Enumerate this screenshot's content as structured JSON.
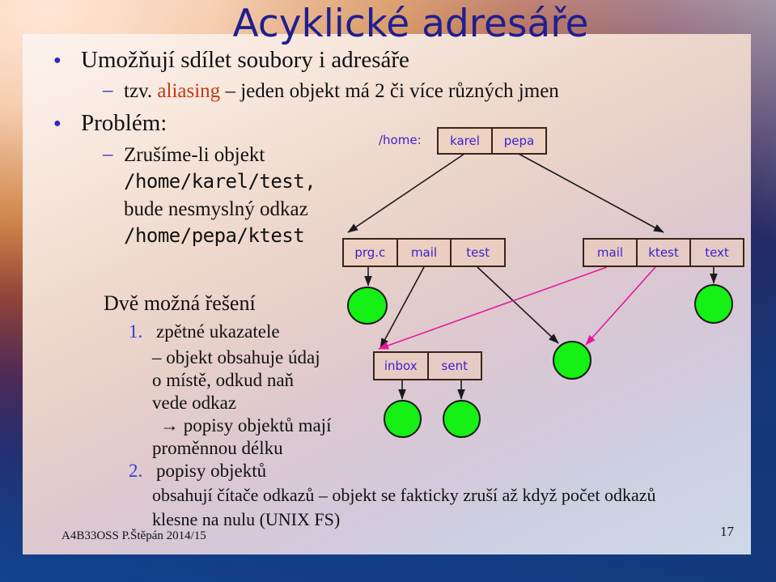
{
  "slide": {
    "title": "Acyklické adresáře",
    "page_number": "17",
    "footer": "A4B33OSS P.Štěpán 2014/15",
    "accent_color": "#1f1f8f",
    "bullet_color": "#2b2bc0",
    "highlight_color": "#c03a12",
    "node_fill_color": "#15f015",
    "link_arrow_color": "#e8159c"
  },
  "bullets": [
    {
      "text": "Umožňují sdílet soubory i adresáře"
    },
    {
      "text": "Problém:"
    }
  ],
  "sub_bullets": [
    {
      "prefix": "tzv. ",
      "highlight": "aliasing",
      "suffix": " – jeden objekt má 2 či více různých jmen"
    }
  ],
  "problem_lines": [
    {
      "text": "Zrušíme-li objekt",
      "mono": false
    },
    {
      "text": "/home/karel/test,",
      "mono": true
    },
    {
      "text": "bude nesmyslný odkaz",
      "mono": false
    },
    {
      "text": "/home/pepa/ktest",
      "mono": true
    }
  ],
  "solutions": {
    "heading": "Dvě možná řešení",
    "items": [
      {
        "number": "1.",
        "title": "zpětné ukazatele",
        "lines": [
          "– objekt obsahuje údaj",
          "o místě, odkud naň",
          "vede odkaz"
        ],
        "arrow_lines": [
          "→  popisy objektů mají",
          "proměnnou délku"
        ]
      },
      {
        "number": "2.",
        "title": "popisy objektů",
        "lines": [
          "obsahují čítače odkazů – objekt se fakticky zruší až když počet odkazů",
          "klesne na nulu (UNIX FS)"
        ]
      }
    ]
  },
  "diagram": {
    "home_label": "/home:",
    "home_entries": [
      "karel",
      "pepa"
    ],
    "karel_entries": [
      "prg.c",
      "mail",
      "test"
    ],
    "pepa_entries": [
      "mail",
      "ktest",
      "text"
    ],
    "mail_entries": [
      "inbox",
      "sent"
    ]
  }
}
